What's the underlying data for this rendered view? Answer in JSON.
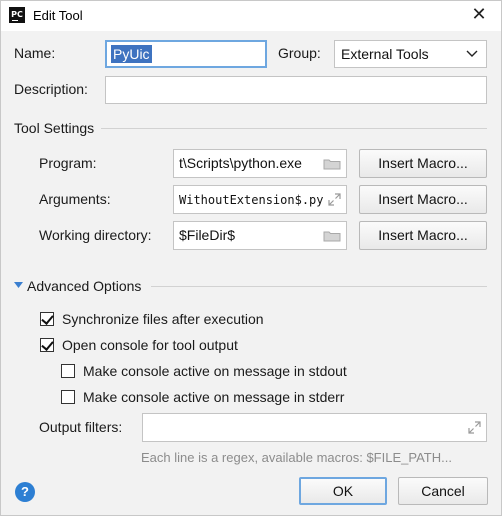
{
  "window": {
    "title": "Edit Tool",
    "app_icon_text": "PC",
    "close_glyph": "✕"
  },
  "form": {
    "name_label": "Name:",
    "name_value": "PyUic",
    "group_label": "Group:",
    "group_value": "External Tools",
    "description_label": "Description:",
    "description_value": ""
  },
  "tool_settings": {
    "section_label": "Tool Settings",
    "program_label": "Program:",
    "program_value": "t\\Scripts\\python.exe",
    "arguments_label": "Arguments:",
    "arguments_value": "WithoutExtension$.py",
    "working_dir_label": "Working directory:",
    "working_dir_value": "$FileDir$",
    "insert_macro_label": "Insert Macro..."
  },
  "advanced": {
    "section_label": "Advanced Options",
    "sync_files": {
      "label": "Synchronize files after execution",
      "checked": true
    },
    "open_console": {
      "label": "Open console for tool output",
      "checked": true
    },
    "console_stdout": {
      "label": "Make console active on message in stdout",
      "checked": false
    },
    "console_stderr": {
      "label": "Make console active on message in stderr",
      "checked": false
    },
    "output_filters_label": "Output filters:",
    "output_filters_value": "",
    "hint": "Each line is a regex, available macros: $FILE_PATH..."
  },
  "buttons": {
    "help": "?",
    "ok": "OK",
    "cancel": "Cancel"
  },
  "colors": {
    "accent": "#3e73c0",
    "focus_border": "#6ea7e0",
    "help_blue": "#2d7fd3",
    "triangle_blue": "#3b7fd0"
  }
}
